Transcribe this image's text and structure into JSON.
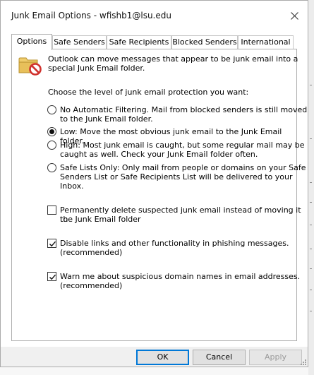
{
  "window": {
    "title": "Junk Email Options - wfishb1@lsu.edu"
  },
  "tabs": [
    {
      "label": "Options",
      "active": true
    },
    {
      "label": "Safe Senders",
      "active": false
    },
    {
      "label": "Safe Recipients",
      "active": false
    },
    {
      "label": "Blocked Senders",
      "active": false
    },
    {
      "label": "International",
      "active": false
    }
  ],
  "options": {
    "intro_line1": "Outlook can move messages that appear to be junk email into a",
    "intro_line2": "special Junk Email folder.",
    "level_prompt": "Choose the level of junk email protection you want:",
    "levels": [
      {
        "lines": [
          "No Automatic Filtering. Mail from blocked senders is still moved",
          "to the Junk Email folder."
        ],
        "selected": false
      },
      {
        "lines": [
          "Low: Move the most obvious junk email to the Junk Email folder."
        ],
        "selected": true
      },
      {
        "lines": [
          "High: Most junk email is caught, but some regular mail may be",
          "caught as well. Check your Junk Email folder often."
        ],
        "selected": false
      },
      {
        "lines": [
          "Safe Lists Only: Only mail from people or domains on your Safe",
          "Senders List or Safe Recipients List will be delivered to your",
          "Inbox."
        ],
        "selected": false
      }
    ],
    "checkboxes": [
      {
        "lines": [
          "Permanently delete suspected junk email instead of moving it to",
          "the Junk Email folder"
        ],
        "checked": false
      },
      {
        "lines": [
          "Disable links and other functionality in phishing messages.",
          "(recommended)"
        ],
        "checked": true
      },
      {
        "lines": [
          "Warn me about suspicious domain names in email addresses.",
          "(recommended)"
        ],
        "checked": true
      }
    ]
  },
  "buttons": {
    "ok": "OK",
    "cancel": "Cancel",
    "apply": "Apply"
  },
  "icons": {
    "close": "close-icon",
    "junk": "junk-folder-blocked-icon",
    "check": "checkmark-icon"
  },
  "colors": {
    "default_button_border": "#0078d7",
    "folder": "#e8c05a",
    "block_sign": "#d0312d"
  }
}
